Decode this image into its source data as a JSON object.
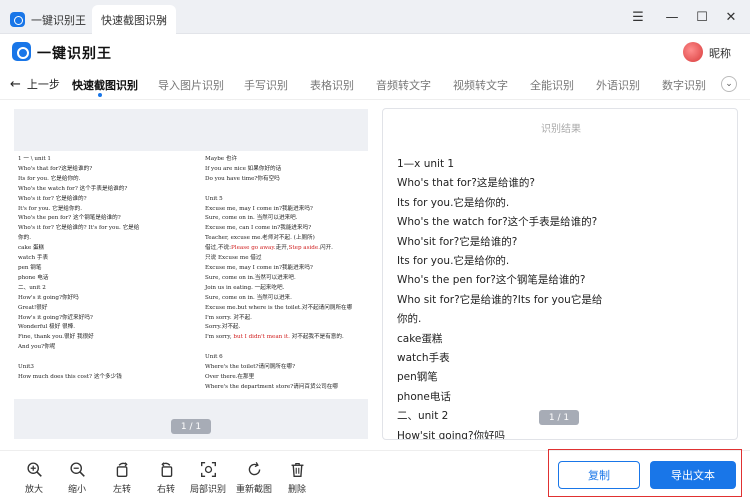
{
  "titlebar": {
    "tabs": [
      {
        "label": "一键识别王"
      },
      {
        "label": "快速截图识别",
        "close": "×"
      }
    ],
    "controls": {
      "menu": "☰",
      "minimize": "—",
      "maximize": "☐",
      "close": "✕"
    }
  },
  "header": {
    "app_name": "一键识别王",
    "nickname": "昵称"
  },
  "nav": {
    "back_label": "上一步",
    "items": [
      "快速截图识别",
      "导入图片识别",
      "手写识别",
      "表格识别",
      "音频转文字",
      "视频转文字",
      "全能识别",
      "外语识别",
      "数字识别"
    ],
    "active": "快速截图识别"
  },
  "document": {
    "left_lines": [
      "1 一 \\ unit 1",
      "Who's that for?这是给谁的?",
      "Its for you. 它是给你的.",
      "Who's the watch for? 这个手表是给谁的?",
      "Who's it for? 它是给谁的?",
      "It's for you. 它是给你的.",
      "Who's the pen for? 这个钢笔是给谁的?",
      "Who's it for? 它是给谁的? It's for you. 它是给",
      "你的.",
      "cake 蛋糕",
      "watch 手表",
      "pen 钢笔",
      "phone 电话",
      "二、unit 2",
      "How's it going?你好吗",
      "Great!很好",
      "How's it going?你近来好吗?",
      "Wonderful 极好    很棒.",
      "Fine, thank you.很好    我很好",
      "And you?你呢",
      "",
      "Unit3",
      "How much does this cost?  这个多少钱"
    ],
    "right_lines": [
      "Maybe 也许",
      "If you are nice 如果你好的话",
      "Do you have time?你有空吗",
      "",
      "Unit 5",
      "Excuse me, may I come in?我能进来吗?",
      "Sure, come on in. 当然可以进来吧.",
      "Excuse me, can I come in?我能进来吗?",
      "Teacher, excuse me.老师对不起. (上厕所)",
      "",
      "只说 Excuse me 借过",
      "Excuse me, may I come in?我能进来吗?",
      "Sure, come on in.当然可以进来吧.",
      "Join us in eating. 一起来吃吧.",
      "Sure, come on in. 当然可以进来.",
      "Excuse me.but where is the toilet.对不起请问厕所在哪",
      "I'm sorry. 对不起.",
      "Sorry.对不起.",
      "",
      "",
      "Unit 6",
      "Where's the toilet?请问厕所在哪?",
      "Over there.在那里",
      "Where's the department store?请问百货公司在哪"
    ],
    "red_line_1": {
      "pre": "借过,不说:",
      "red1": "Please go away.",
      "mid": "走开,",
      "red2": "Step aside.",
      "post": "闪开."
    },
    "red_line_2": {
      "pre": "I'm sorry, ",
      "red": "but I didn't mean it.",
      "post": " 对不起我不是有意的."
    },
    "pager": "1 / 1"
  },
  "result": {
    "title": "识别结果",
    "lines": [
      "1—x unit 1",
      "Who's that for?这是给谁的?",
      "Its for you.它是给你的.",
      "Who's the watch for?这个手表是给谁的?",
      "Who'sit for?它是给谁的?",
      "Its for you.它是给你的.",
      "Who's the pen for?这个钢笔是给谁的?",
      "Who sit for?它是给谁的?Its for you它是给",
      "你的.",
      "cake蛋糕",
      "watch手表",
      "pen钢笔",
      "phone电话",
      "二、unit 2",
      "How'sit going?你好吗"
    ],
    "pager": "1 / 1"
  },
  "toolbar": {
    "tools": [
      {
        "label": "放大",
        "icon": "zoom-in-icon"
      },
      {
        "label": "缩小",
        "icon": "zoom-out-icon"
      },
      {
        "label": "左转",
        "icon": "rotate-left-icon"
      },
      {
        "label": "右转",
        "icon": "rotate-right-icon"
      },
      {
        "label": "局部识别",
        "icon": "partial-recognize-icon"
      },
      {
        "label": "重新截图",
        "icon": "refresh-icon"
      },
      {
        "label": "删除",
        "icon": "trash-icon"
      }
    ],
    "copy_label": "复制",
    "export_label": "导出文本"
  },
  "colors": {
    "accent": "#1976e8",
    "highlight_border": "#e03131",
    "red_text": "#d02020"
  }
}
